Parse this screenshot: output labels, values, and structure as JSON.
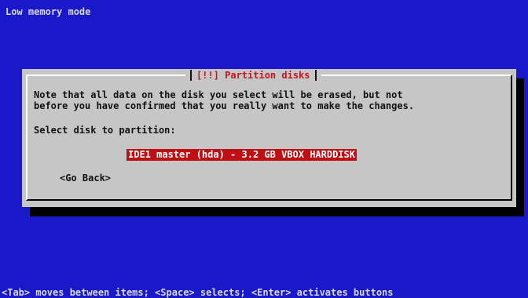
{
  "header": {
    "text": "Low memory mode"
  },
  "dialog": {
    "title": "[!!] Partition disks",
    "description_lines": [
      "Note that all data on the disk you select will be erased, but not",
      "before you have confirmed that you really want to make the changes."
    ],
    "prompt": "Select disk to partition:",
    "options": [
      {
        "label": "IDE1 master (hda) - 3.2 GB VBOX HARDDISK",
        "selected": true
      }
    ],
    "back_button": "<Go Back>"
  },
  "footer": {
    "text": "<Tab> moves between items; <Space> selects; <Enter> activates buttons"
  },
  "colors": {
    "background": "#1919c9",
    "dialog": "#c6c6c6",
    "title": "#c8141d",
    "selection": "#bf0f15"
  }
}
